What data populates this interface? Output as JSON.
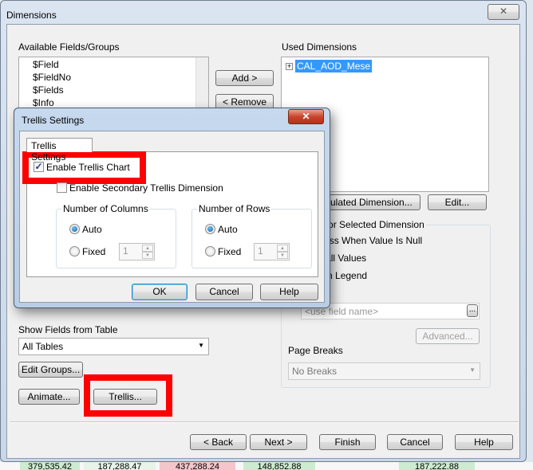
{
  "dialog": {
    "title": "Dimensions",
    "close_icon": "close-icon"
  },
  "available": {
    "label": "Available Fields/Groups",
    "items": [
      "$Field",
      "$FieldNo",
      "$Fields",
      "$Info"
    ]
  },
  "add_label": "Add >",
  "remove_label": "< Remove",
  "used": {
    "label": "Used Dimensions",
    "items": [
      "CAL_AOD_Mese"
    ]
  },
  "add_calc_label": "Add Calculated Dimension...",
  "edit_label": "Edit...",
  "settings": {
    "legend": "Settings for Selected Dimension",
    "suppress": "Suppress When Value Is Null",
    "show_all": "Show All Values",
    "show_legend": "Show in Legend",
    "field_placeholder": "<use field name>",
    "browse_label": "...",
    "advanced_label": "Advanced...",
    "page_breaks_label": "Page Breaks",
    "page_breaks_value": "No Breaks"
  },
  "show_fields": {
    "label": "Show Fields from Table",
    "value": "All Tables"
  },
  "edit_groups_label": "Edit Groups...",
  "animate_label": "Animate...",
  "trellis_label": "Trellis...",
  "footer": {
    "back": "< Back",
    "next": "Next >",
    "finish": "Finish",
    "cancel": "Cancel",
    "help": "Help"
  },
  "trellis": {
    "title": "Trellis Settings",
    "tab": "Trellis Settings",
    "enable": "Enable Trellis Chart",
    "enable_checked": true,
    "secondary": "Enable Secondary Trellis Dimension",
    "secondary_checked": false,
    "columns": {
      "legend": "Number of Columns",
      "auto": "Auto",
      "fixed": "Fixed",
      "value": "1",
      "selected": "Auto"
    },
    "rows": {
      "legend": "Number of Rows",
      "auto": "Auto",
      "fixed": "Fixed",
      "value": "1",
      "selected": "Auto"
    },
    "ok": "OK",
    "cancel": "Cancel",
    "help": "Help"
  },
  "highlight_color": "#ff0000",
  "background_values": [
    "379,535.42",
    "187,288.47",
    "437,288.24",
    "148,852.88",
    "187,222.88"
  ]
}
